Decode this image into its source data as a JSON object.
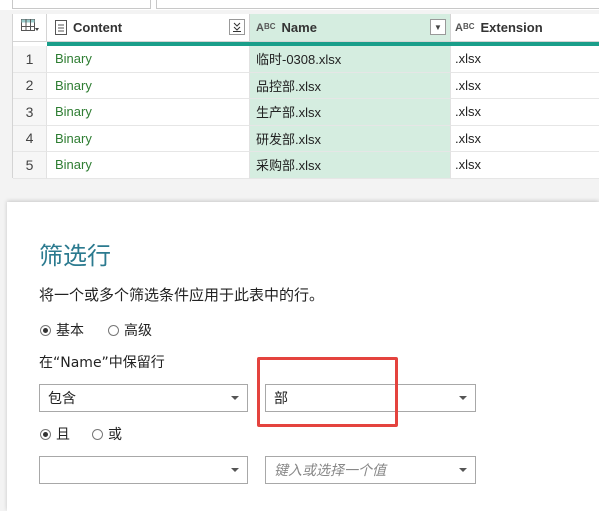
{
  "grid": {
    "columns": [
      {
        "label": "Content",
        "type_icon": "table-icon"
      },
      {
        "label": "Name",
        "type_icon": "abc-text-icon"
      },
      {
        "label": "Extension",
        "type_icon": "abc-text-icon"
      }
    ],
    "rows": [
      {
        "num": "1",
        "content": "Binary",
        "name": "临时-0308.xlsx",
        "ext": ".xlsx"
      },
      {
        "num": "2",
        "content": "Binary",
        "name": "品控部.xlsx",
        "ext": ".xlsx"
      },
      {
        "num": "3",
        "content": "Binary",
        "name": "生产部.xlsx",
        "ext": ".xlsx"
      },
      {
        "num": "4",
        "content": "Binary",
        "name": "研发部.xlsx",
        "ext": ".xlsx"
      },
      {
        "num": "5",
        "content": "Binary",
        "name": "采购部.xlsx",
        "ext": ".xlsx"
      }
    ]
  },
  "dialog": {
    "title": "筛选行",
    "description": "将一个或多个筛选条件应用于此表中的行。",
    "mode_basic": "基本",
    "mode_advanced": "高级",
    "keep_rows_label": "在“Name”中保留行",
    "operator_1": "包含",
    "value_1": "部",
    "logic_and": "且",
    "logic_or": "或",
    "operator_2": "",
    "value_2_placeholder": "键入或选择一个值"
  },
  "colors": {
    "accent_teal": "#1a9e8a",
    "selected_column": "#d5ede0",
    "binary_text": "#2e7d32",
    "title_color": "#2b7a8f",
    "highlight_red": "#e4433e"
  }
}
